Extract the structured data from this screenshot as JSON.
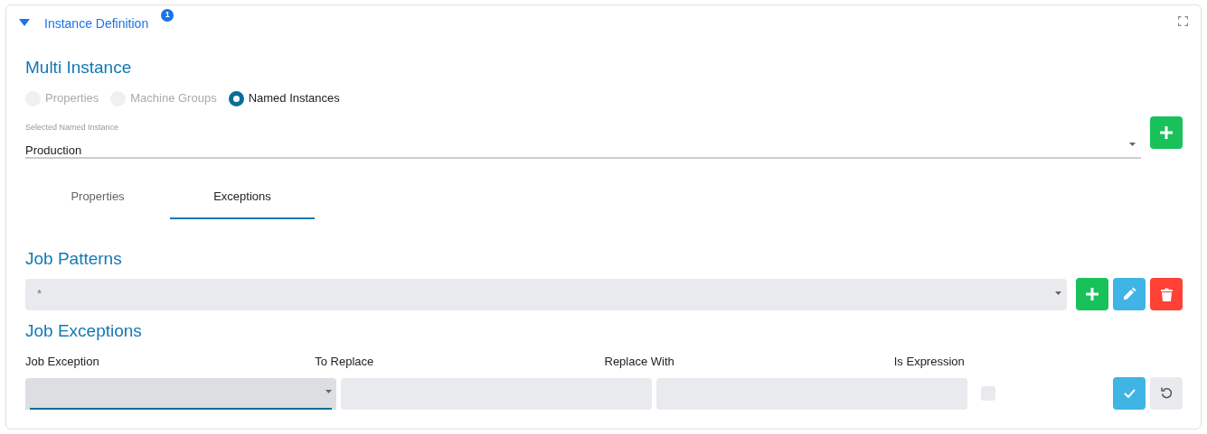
{
  "panel": {
    "title": "Instance Definition",
    "badge": "1",
    "expanded": true
  },
  "multi_instance": {
    "title": "Multi Instance",
    "modes": [
      {
        "label": "Properties",
        "selected": false,
        "disabled": true
      },
      {
        "label": "Machine Groups",
        "selected": false,
        "disabled": true
      },
      {
        "label": "Named Instances",
        "selected": true,
        "disabled": false
      }
    ],
    "named_instance": {
      "label": "Selected Named Instance",
      "value": "Production"
    }
  },
  "tabs": [
    {
      "label": "Properties",
      "selected": false
    },
    {
      "label": "Exceptions",
      "selected": true
    }
  ],
  "job_patterns": {
    "title": "Job Patterns",
    "value": "*"
  },
  "job_exceptions": {
    "title": "Job Exceptions",
    "columns": [
      "Job Exception",
      "To Replace",
      "Replace With",
      "Is Expression"
    ],
    "row": {
      "focused": true,
      "is_expression": false
    }
  }
}
